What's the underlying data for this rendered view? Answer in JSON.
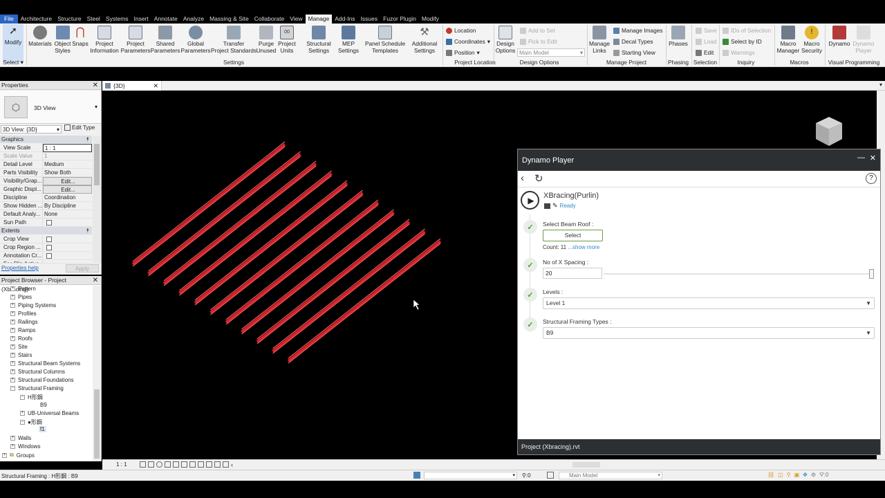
{
  "ribbon_tabs": [
    "File",
    "Architecture",
    "Structure",
    "Steel",
    "Systems",
    "Insert",
    "Annotate",
    "Analyze",
    "Massing & Site",
    "Collaborate",
    "View",
    "Manage",
    "Add-Ins",
    "Issues",
    "Fuzor Plugin",
    "Modify"
  ],
  "ribbon": {
    "modify": "Modify",
    "select": "Select",
    "materials": "Materials",
    "object_styles": "Object\nStyles",
    "snaps": "Snaps",
    "project_information": "Project\nInformation",
    "project_parameters": "Project\nParameters",
    "shared_parameters": "Shared\nParameters",
    "global_parameters": "Global\nParameters",
    "transfer_standards": "Transfer\nProject Standards",
    "purge_unused": "Purge\nUnused",
    "project_units": "Project\nUnits",
    "settings_group": "Settings",
    "structural_settings": "Structural\nSettings",
    "mep_settings": "MEP\nSettings",
    "panel_schedule_templates": "Panel Schedule\nTemplates",
    "additional_settings": "Additional\nSettings",
    "location": "Location",
    "coordinates": "Coordinates",
    "position": "Position",
    "project_location_group": "Project Location",
    "design_options_btn": "Design\nOptions",
    "add_to_set": "Add to Set",
    "pick_to_edit": "Pick to Edit",
    "main_model": "Main Model",
    "design_options_group": "Design Options",
    "manage_links": "Manage\nLinks",
    "manage_images": "Manage  Images",
    "decal_types": "Decal  Types",
    "starting_view": "Starting  View",
    "manage_project_group": "Manage Project",
    "phases": "Phases",
    "phasing_group": "Phasing",
    "save": "Save",
    "load": "Load",
    "edit": "Edit",
    "selection_group": "Selection",
    "ids_of_selection": "IDs of  Selection",
    "select_by_id": "Select  by ID",
    "warnings": "Warnings",
    "inquiry_group": "Inquiry",
    "macro_manager": "Macro\nManager",
    "macro_security": "Macro\nSecurity",
    "macros_group": "Macros",
    "dynamo": "Dynamo",
    "dynamo_player": "Dynamo\nPlayer",
    "visual_programming_group": "Visual Programming"
  },
  "properties": {
    "title": "Properties",
    "type_name": "3D View",
    "view_selector": "3D View: {3D}",
    "edit_type": "Edit Type",
    "graphics_section": "Graphics",
    "rows": [
      {
        "k": "View Scale",
        "v": "1 : 1"
      },
      {
        "k": "Scale Value",
        "v": "1"
      },
      {
        "k": "Detail Level",
        "v": "Medium"
      },
      {
        "k": "Parts Visibility",
        "v": "Show Both"
      },
      {
        "k": "Visibility/Grap...",
        "v": "Edit..."
      },
      {
        "k": "Graphic Displ...",
        "v": "Edit..."
      },
      {
        "k": "Discipline",
        "v": "Coordination"
      },
      {
        "k": "Show Hidden ...",
        "v": "By Discipline"
      },
      {
        "k": "Default Analy...",
        "v": "None"
      },
      {
        "k": "Sun Path",
        "v": ""
      }
    ],
    "extents_section": "Extents",
    "extents_rows": [
      "Crop View",
      "Crop Region ...",
      "Annotation Cr...",
      "Far Clip Active"
    ],
    "help_link": "Properties help",
    "apply": "Apply"
  },
  "project_browser": {
    "title": "Project Browser - Project (Xbracing)",
    "items": [
      "Pattern",
      "Pipes",
      "Piping Systems",
      "Profiles",
      "Railings",
      "Ramps",
      "Roofs",
      "Site",
      "Stairs",
      "Structural Beam Systems",
      "Structural Columns",
      "Structural Foundations",
      "Structural Framing"
    ],
    "framing_children": [
      {
        "label": "H形鋼",
        "child": "B9"
      },
      {
        "label": "UB-Universal Beams",
        "child": ""
      },
      {
        "label": "●形鋼",
        "child": "f1"
      }
    ],
    "after": [
      "Walls",
      "Windows"
    ],
    "groups": "Groups"
  },
  "view_tab": "{3D}",
  "view_scale": "1 : 1",
  "status_text": "Structural Framing : H形鋼 : B9",
  "status_zero": ":0",
  "status_model": "Main Model",
  "status_filter": ":0",
  "dynamo": {
    "title": "Dynamo Player",
    "script_name": "XBracing(Purlin)",
    "status": "Ready",
    "fields": [
      {
        "label": "Select Beam Roof :",
        "button": "Select",
        "count": "Count: 11",
        "more": "...show more"
      },
      {
        "label": "No of X Spacing :",
        "value": "20"
      },
      {
        "label": "Levels :",
        "value": "Level 1"
      },
      {
        "label": "Structural Framing Types :",
        "value": "B9"
      }
    ],
    "footer": "Project (Xbracing).rvt"
  },
  "colors": {
    "beam": "#d8232a",
    "file_tab": "#2b66c4",
    "dyn_header": "#2d3033"
  }
}
